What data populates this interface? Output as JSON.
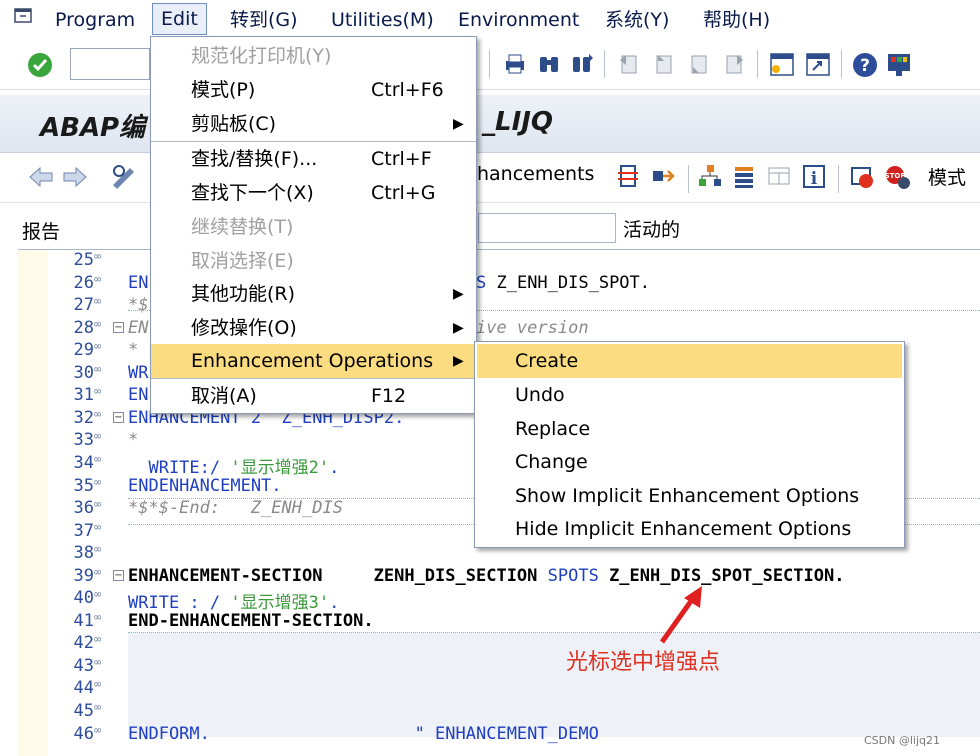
{
  "menubar": {
    "items": [
      "Program",
      "Edit",
      "转到(G)",
      "Utilities(M)",
      "Environment",
      "系统(Y)",
      "帮助(H)"
    ]
  },
  "title": {
    "left": "ABAP编",
    "right": "_LIJQ"
  },
  "apptoolbar": {
    "enhancements_label": "hancements",
    "mode_label": "模式"
  },
  "report": {
    "label": "报告",
    "status": "活动的"
  },
  "editor": {
    "lines": [
      {
        "n": "25",
        "text": ""
      },
      {
        "n": "26",
        "text": "EN                               TS Z_ENH_DIS_SPOT."
      },
      {
        "n": "27",
        "text": "*$"
      },
      {
        "n": "28",
        "text": "EN                             active version"
      },
      {
        "n": "29",
        "text": "*"
      },
      {
        "n": "30",
        "text": "WR"
      },
      {
        "n": "31",
        "text": "EN"
      },
      {
        "n": "32",
        "text": "ENHANCEMENT 2  Z_ENH_DISP2."
      },
      {
        "n": "33",
        "text": "*"
      },
      {
        "n": "34",
        "text": "  WRITE:/ '显示增强2'."
      },
      {
        "n": "35",
        "text": "ENDENHANCEMENT."
      },
      {
        "n": "36",
        "text": "*$*$-End:   Z_ENH_DIS"
      },
      {
        "n": "37",
        "text": ""
      },
      {
        "n": "38",
        "text": ""
      },
      {
        "n": "39",
        "text": "ENHANCEMENT-SECTION     ZENH_DIS_SECTION SPOTS Z_ENH_DIS_SPOT_SECTION."
      },
      {
        "n": "40",
        "text": "WRITE : / '显示增强3'."
      },
      {
        "n": "41",
        "text": "END-ENHANCEMENT-SECTION."
      },
      {
        "n": "42",
        "text": ""
      },
      {
        "n": "43",
        "text": ""
      },
      {
        "n": "44",
        "text": ""
      },
      {
        "n": "45",
        "text": ""
      },
      {
        "n": "46",
        "text": "ENDFORM.                    \" ENHANCEMENT_DEMO"
      }
    ]
  },
  "editmenu": {
    "items": [
      {
        "label": "规范化打印机(Y)",
        "shortcut": "",
        "disabled": true,
        "submenu": false
      },
      {
        "label": "模式(P)",
        "shortcut": "Ctrl+F6",
        "disabled": false,
        "submenu": false
      },
      {
        "label": "剪贴板(C)",
        "shortcut": "",
        "disabled": false,
        "submenu": true
      },
      {
        "label": "查找/替换(F)...",
        "shortcut": "Ctrl+F",
        "disabled": false,
        "submenu": false
      },
      {
        "label": "查找下一个(X)",
        "shortcut": "Ctrl+G",
        "disabled": false,
        "submenu": false
      },
      {
        "label": "继续替换(T)",
        "shortcut": "",
        "disabled": true,
        "submenu": false
      },
      {
        "label": "取消选择(E)",
        "shortcut": "",
        "disabled": true,
        "submenu": false
      },
      {
        "label": "其他功能(R)",
        "shortcut": "",
        "disabled": false,
        "submenu": true
      },
      {
        "label": "修改操作(O)",
        "shortcut": "",
        "disabled": false,
        "submenu": true
      },
      {
        "label": "Enhancement Operations",
        "shortcut": "",
        "disabled": false,
        "submenu": true
      },
      {
        "label": "取消(A)",
        "shortcut": "F12",
        "disabled": false,
        "submenu": false
      }
    ]
  },
  "submenu": {
    "items": [
      "Create",
      "Undo",
      "Replace",
      "Change",
      "Show Implicit Enhancement Options",
      "Hide Implicit Enhancement Options"
    ]
  },
  "annotation": "光标选中增强点",
  "watermark": "CSDN @lijq21"
}
